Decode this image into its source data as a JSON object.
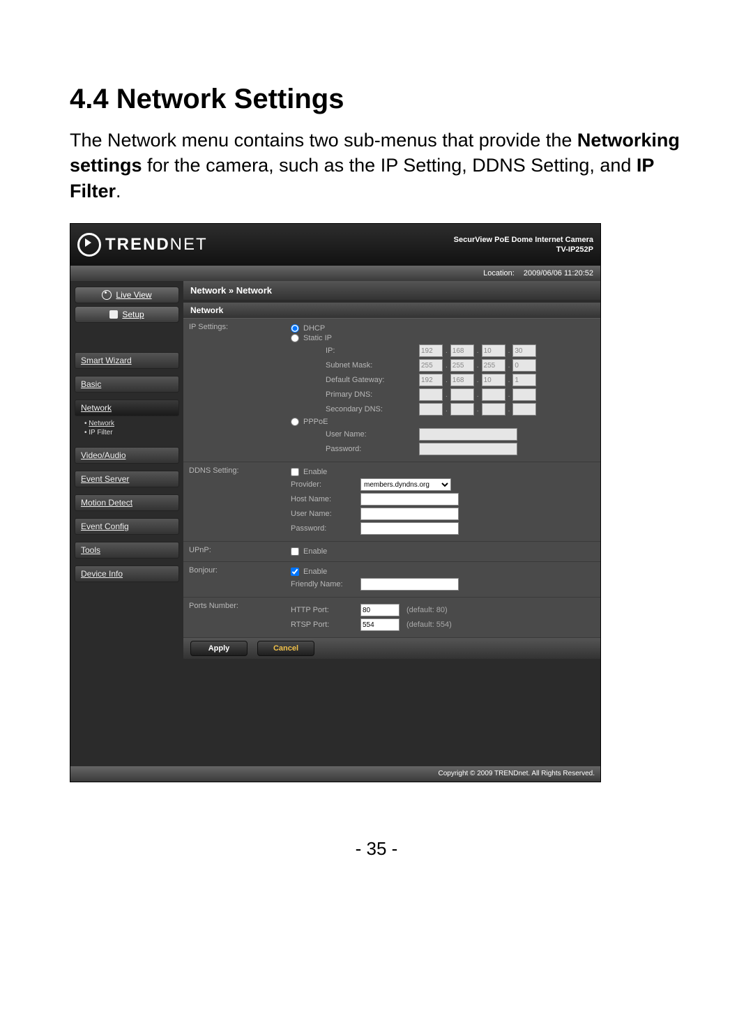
{
  "doc": {
    "heading": "4.4  Network Settings",
    "intro_part1": "The Network menu contains two sub-menus that provide the ",
    "intro_bold1": "Networking settings",
    "intro_part2": " for the camera, such as the IP Setting, DDNS Setting, and ",
    "intro_bold2": "IP Filter",
    "intro_part3": ".",
    "page_number": "- 35 -"
  },
  "header": {
    "brand1": "TREND",
    "brand2": "NET",
    "product_line1": "SecurView PoE Dome Internet Camera",
    "product_line2": "TV-IP252P",
    "location_label": "Location:",
    "location_value": "2009/06/06 11:20:52"
  },
  "sidebar": {
    "live_view": "Live View",
    "setup": "Setup",
    "items": [
      "Smart Wizard",
      "Basic",
      "Network",
      "Video/Audio",
      "Event Server",
      "Motion Detect",
      "Event Config",
      "Tools",
      "Device Info"
    ],
    "sub_network": [
      "Network",
      "IP Filter"
    ]
  },
  "main": {
    "breadcrumb": "Network » Network",
    "section": "Network",
    "rows": {
      "ip_settings": "IP Settings:",
      "ddns": "DDNS Setting:",
      "upnp": "UPnP:",
      "bonjour": "Bonjour:",
      "ports": "Ports Number:"
    },
    "ip": {
      "dhcp": "DHCP",
      "static": "Static IP",
      "ip_label": "IP:",
      "subnet_label": "Subnet Mask:",
      "gateway_label": "Default Gateway:",
      "pdns_label": "Primary DNS:",
      "sdns_label": "Secondary DNS:",
      "pppoe": "PPPoE",
      "user_label": "User Name:",
      "pass_label": "Password:",
      "ip_oct": [
        "192",
        "168",
        "10",
        "30"
      ],
      "mask_oct": [
        "255",
        "255",
        "255",
        "0"
      ],
      "gw_oct": [
        "192",
        "168",
        "10",
        "1"
      ],
      "pdns_oct": [
        "",
        "",
        "",
        ""
      ],
      "sdns_oct": [
        "",
        "",
        "",
        ""
      ]
    },
    "ddns": {
      "enable": "Enable",
      "provider_label": "Provider:",
      "provider_value": "members.dyndns.org",
      "host_label": "Host Name:",
      "user_label": "User Name:",
      "pass_label": "Password:"
    },
    "upnp": {
      "enable": "Enable"
    },
    "bonjour": {
      "enable": "Enable",
      "friendly_label": "Friendly Name:"
    },
    "ports": {
      "http_label": "HTTP Port:",
      "http_value": "80",
      "http_hint": "(default: 80)",
      "rtsp_label": "RTSP Port:",
      "rtsp_value": "554",
      "rtsp_hint": "(default: 554)"
    },
    "apply": "Apply",
    "cancel": "Cancel"
  },
  "footer": "Copyright © 2009 TRENDnet. All Rights Reserved."
}
